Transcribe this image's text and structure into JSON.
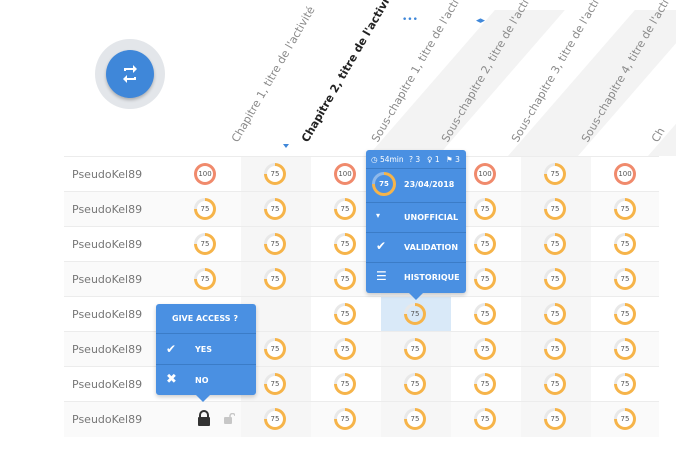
{
  "columns": [
    {
      "title": "Chapitre 1, titre de l'activité",
      "active": false
    },
    {
      "title": "Chapitre 2, titre de l'activité",
      "active": true
    },
    {
      "title": "Sous-chapitre 1, titre de l'activité",
      "active": false
    },
    {
      "title": "Sous-chapitre 2, titre de l'activité",
      "active": false
    },
    {
      "title": "Sous-chapitre 3, titre de l'activité",
      "active": false
    },
    {
      "title": "Sous-chapitre 4, titre de l'activité",
      "active": false
    },
    {
      "title": "Ch",
      "active": false
    }
  ],
  "header_indicators": {
    "dots": "•••",
    "arrows": "◂▸"
  },
  "rows": [
    {
      "pseudo": "PseudoKel89",
      "scores": [
        "100",
        "75",
        "100",
        "",
        "100",
        "75",
        "100"
      ]
    },
    {
      "pseudo": "PseudoKel89",
      "scores": [
        "75",
        "75",
        "75",
        "",
        "75",
        "75",
        "75"
      ]
    },
    {
      "pseudo": "PseudoKel89",
      "scores": [
        "75",
        "75",
        "75",
        "",
        "75",
        "75",
        "75"
      ]
    },
    {
      "pseudo": "PseudoKel89",
      "scores": [
        "75",
        "75",
        "75",
        "",
        "75",
        "75",
        "75"
      ]
    },
    {
      "pseudo": "PseudoKel89",
      "scores": [
        "",
        "",
        "75",
        "75",
        "75",
        "75",
        "75"
      ]
    },
    {
      "pseudo": "PseudoKel89",
      "scores": [
        "",
        "75",
        "75",
        "75",
        "75",
        "75",
        "75"
      ]
    },
    {
      "pseudo": "PseudoKel89",
      "scores": [
        "",
        "75",
        "75",
        "75",
        "75",
        "75",
        "75"
      ]
    },
    {
      "pseudo": "PseudoKel89",
      "scores": [
        "",
        "75",
        "75",
        "75",
        "75",
        "75",
        "75"
      ]
    }
  ],
  "score_fraction": {
    "100": 1.0,
    "75": 0.75
  },
  "colors": {
    "accent": "#4a90e2",
    "ring_fill": "#f6b44a",
    "ring_full": "#f08a6c",
    "ring_track": "#e8e8e8"
  },
  "activity_popup": {
    "duration": "54min",
    "questions": "3",
    "hints": "1",
    "flags": "3",
    "score": "75",
    "date": "23/04/2018",
    "items": [
      {
        "icon": "caret-down-icon",
        "label": "UNOFFICIAL"
      },
      {
        "icon": "check-icon",
        "label": "VALIDATION"
      },
      {
        "icon": "list-icon",
        "label": "HISTORIQUE"
      }
    ]
  },
  "access_popup": {
    "title": "GIVE ACCESS ?",
    "yes": "YES",
    "no": "NO"
  }
}
